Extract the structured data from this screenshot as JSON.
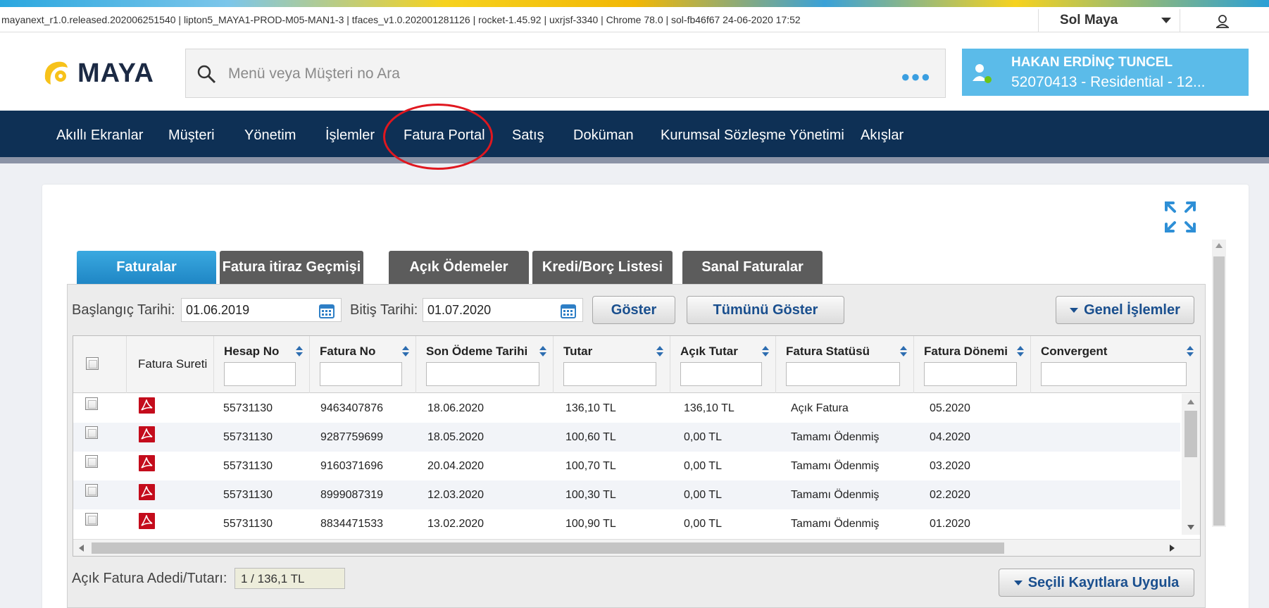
{
  "infobar": {
    "text": "mayanext_r1.0.released.202006251540 | lipton5_MAYA1-PROD-M05-MAN1-3 | tfaces_v1.0.202001281126 | rocket-1.45.92 | uxrjsf-3340 | Chrome 78.0 | sol-fb46f67 24-06-2020 17:52",
    "user_select": "Sol Maya",
    "profile_icon": "user-silhouette-icon"
  },
  "header": {
    "logo_text": "MAYA",
    "search_placeholder": "Menü veya Müşteri no Ara",
    "more_icon": "more-dots-icon",
    "customer_name": "HAKAN ERDİNÇ TUNCEL",
    "customer_sub": "52070413 - Residential - 12..."
  },
  "nav": {
    "items": [
      {
        "label": "Akıllı Ekranlar"
      },
      {
        "label": "Müşteri"
      },
      {
        "label": "Yönetim"
      },
      {
        "label": "İşlemler"
      },
      {
        "label": "Fatura Portal"
      },
      {
        "label": "Satış"
      },
      {
        "label": "Doküman"
      },
      {
        "label": "Kurumsal Sözleşme Yönetimi"
      },
      {
        "label": "Akışlar"
      }
    ],
    "highlight_color": "#e0171f"
  },
  "tabs": [
    {
      "label": "Faturalar",
      "active": true
    },
    {
      "label": "Fatura itiraz Geçmişi"
    },
    {
      "label": "Açık Ödemeler"
    },
    {
      "label": "Kredi/Borç Listesi"
    },
    {
      "label": "Sanal Faturalar"
    }
  ],
  "filters": {
    "start_label": "Başlangıç Tarihi:",
    "start_value": "01.06.2019",
    "end_label": "Bitiş Tarihi:",
    "end_value": "01.07.2020",
    "show_button": "Göster",
    "show_all_button": "Tümünü Göster",
    "general_ops_button": "Genel İşlemler"
  },
  "table": {
    "columns": [
      "Fatura Sureti",
      "Hesap No",
      "Fatura No",
      "Son Ödeme Tarihi",
      "Tutar",
      "Açık Tutar",
      "Fatura Statüsü",
      "Fatura Dönemi",
      "Convergent"
    ],
    "rows": [
      {
        "hesap": "55731130",
        "fatura": "9463407876",
        "son_odeme": "18.06.2020",
        "tutar": "136,10 TL",
        "acik": "136,10 TL",
        "statu": "Açık Fatura",
        "donem": "05.2020",
        "convergent": ""
      },
      {
        "hesap": "55731130",
        "fatura": "9287759699",
        "son_odeme": "18.05.2020",
        "tutar": "100,60 TL",
        "acik": "0,00 TL",
        "statu": "Tamamı Ödenmiş",
        "donem": "04.2020",
        "convergent": ""
      },
      {
        "hesap": "55731130",
        "fatura": "9160371696",
        "son_odeme": "20.04.2020",
        "tutar": "100,70 TL",
        "acik": "0,00 TL",
        "statu": "Tamamı Ödenmiş",
        "donem": "03.2020",
        "convergent": ""
      },
      {
        "hesap": "55731130",
        "fatura": "8999087319",
        "son_odeme": "12.03.2020",
        "tutar": "100,30 TL",
        "acik": "0,00 TL",
        "statu": "Tamamı Ödenmiş",
        "donem": "02.2020",
        "convergent": ""
      },
      {
        "hesap": "55731130",
        "fatura": "8834471533",
        "son_odeme": "13.02.2020",
        "tutar": "100,90 TL",
        "acik": "0,00 TL",
        "statu": "Tamamı Ödenmiş",
        "donem": "01.2020",
        "convergent": ""
      }
    ]
  },
  "summary": {
    "label": "Açık Fatura Adedi/Tutarı:",
    "value": "1 / 136,1 TL",
    "apply_button": "Seçili Kayıtlara Uygula"
  }
}
